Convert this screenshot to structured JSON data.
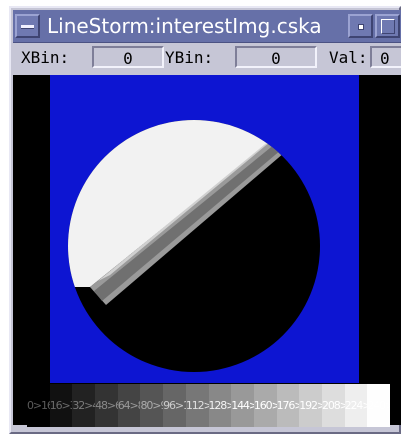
{
  "window": {
    "title": "LineStorm:interestImg.cska"
  },
  "infobar": {
    "xbin_label": "XBin:",
    "xbin_value": "0",
    "ybin_label": "YBin:",
    "ybin_value": "0",
    "val_label": "Val:",
    "val_value": "0"
  },
  "colors": {
    "titlebar": "#6670a8",
    "window_bg": "#c6c6d6",
    "image_bg": "#0d15d2",
    "disc_dark": "#000000",
    "disc_light": "#f2f2f2"
  },
  "icons": {
    "window_menu": "window-menu-icon",
    "minimize": "minimize-icon",
    "maximize": "maximize-icon"
  },
  "colorbar": {
    "segments": [
      {
        "label": "0>16",
        "color": "#000000",
        "text_color": "#5a5a5a"
      },
      {
        "label": "16>32",
        "color": "#111111",
        "text_color": "#6a6a6a"
      },
      {
        "label": "32>48",
        "color": "#222222",
        "text_color": "#7a7a7a"
      },
      {
        "label": "48>64",
        "color": "#333333",
        "text_color": "#888888"
      },
      {
        "label": "64>80",
        "color": "#444444",
        "text_color": "#9a9a9a"
      },
      {
        "label": "80>96",
        "color": "#555555",
        "text_color": "#aaaaaa"
      },
      {
        "label": "96>112",
        "color": "#666666",
        "text_color": "#cccccc"
      },
      {
        "label": "112>128",
        "color": "#777777",
        "text_color": "#e0e0e0"
      },
      {
        "label": "128>144",
        "color": "#888888",
        "text_color": "#f4f4f4"
      },
      {
        "label": "144>160",
        "color": "#999999",
        "text_color": "#ffffff"
      },
      {
        "label": "160>176",
        "color": "#aaaaaa",
        "text_color": "#ffffff"
      },
      {
        "label": "176>192",
        "color": "#bbbbbb",
        "text_color": "#ffffff"
      },
      {
        "label": "192>208",
        "color": "#cccccc",
        "text_color": "#ffffff"
      },
      {
        "label": "208>224",
        "color": "#dddddd",
        "text_color": "#ffffff"
      },
      {
        "label": "224>240",
        "color": "#eeeeee",
        "text_color": "#ffffff"
      },
      {
        "label": "240>256",
        "color": "#fefefe",
        "text_color": "#ffffff"
      }
    ]
  }
}
